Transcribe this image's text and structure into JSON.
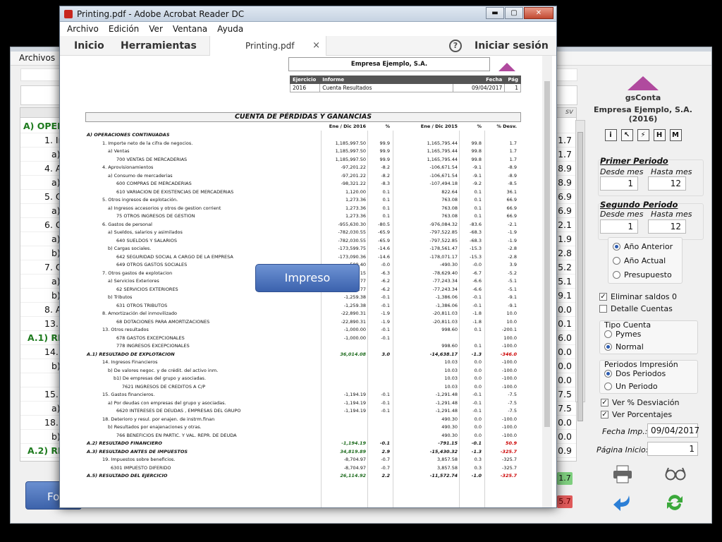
{
  "bg_app": {
    "menu_archivos": "Archivos",
    "rows": [
      {
        "label": "A) OPERA",
        "indent": 18,
        "value": "",
        "green": true
      },
      {
        "label": "1. In",
        "indent": 48,
        "value": "1.7"
      },
      {
        "label": "a)",
        "indent": 58,
        "value": "1.7"
      },
      {
        "label": "4. Ap",
        "indent": 48,
        "value": "8.9"
      },
      {
        "label": "a)",
        "indent": 58,
        "value": "8.9"
      },
      {
        "label": "5. O",
        "indent": 48,
        "value": "6.9"
      },
      {
        "label": "a)",
        "indent": 58,
        "value": "6.9"
      },
      {
        "label": "6. G",
        "indent": 48,
        "value": "2.1"
      },
      {
        "label": "a)",
        "indent": 58,
        "value": "1.9"
      },
      {
        "label": "b)",
        "indent": 58,
        "value": "2.8"
      },
      {
        "label": "7. O",
        "indent": 48,
        "value": "5.2"
      },
      {
        "label": "a)",
        "indent": 58,
        "value": "5.1"
      },
      {
        "label": "b)",
        "indent": 58,
        "value": "9.1"
      },
      {
        "label": "8. Ar",
        "indent": 48,
        "value": "0.0"
      },
      {
        "label": "13. C",
        "indent": 48,
        "value": "0.1"
      },
      {
        "label": "A.1) RES",
        "indent": 24,
        "value": "6.0",
        "green": true
      },
      {
        "label": "14. I",
        "indent": 48,
        "value": "0.0"
      },
      {
        "label": "b)",
        "indent": 58,
        "value": "0.0"
      },
      {
        "label": "",
        "indent": 58,
        "value": "0.0"
      },
      {
        "label": "15. (",
        "indent": 48,
        "value": "7.5"
      },
      {
        "label": "a)",
        "indent": 58,
        "value": "7.5"
      },
      {
        "label": "18. D",
        "indent": 48,
        "value": "0.0"
      },
      {
        "label": "b)",
        "indent": 58,
        "value": "0.0"
      },
      {
        "label": "A.2) RES",
        "indent": 24,
        "value": "0.9",
        "green": true
      }
    ],
    "header_sv": "sv",
    "badge_green": "1.7",
    "badge_red": "5.7",
    "fo_button": "Fo"
  },
  "right_panel": {
    "app_name": "gsConta",
    "company": "Empresa Ejemplo, S.A.",
    "year": "(2016)",
    "tool_icons": [
      "i",
      "↖",
      "⚡",
      "H",
      "M"
    ],
    "primer_periodo": {
      "title": "Primer Periodo",
      "desde_label": "Desde mes",
      "hasta_label": "Hasta mes",
      "desde": "1",
      "hasta": "12"
    },
    "segundo_periodo": {
      "title": "Segundo Periodo",
      "desde_label": "Desde mes",
      "hasta_label": "Hasta mes",
      "desde": "1",
      "hasta": "12"
    },
    "compare_options": [
      "Año Anterior",
      "Año Actual",
      "Presupuesto"
    ],
    "compare_selected": 0,
    "eliminar_saldos": "Eliminar saldos 0",
    "detalle_cuentas": "Detalle Cuentas",
    "tipo_cuenta": {
      "title": "Tipo Cuenta",
      "options": [
        "Pymes",
        "Normal"
      ],
      "selected": 1
    },
    "periodos_impresion": {
      "title": "Periodos Impresión",
      "options": [
        "Dos Periodos",
        "Un Periodo"
      ],
      "selected": 0
    },
    "ver_desviacion": "Ver % Desviación",
    "ver_porcentajes": "Ver Porcentajes",
    "fecha_imp_label": "Fecha Imp.:",
    "fecha_imp": "09/04/2017",
    "pagina_inicio_label": "Página Inicio:",
    "pagina_inicio": "1"
  },
  "acrobat": {
    "title": "Printing.pdf - Adobe Acrobat Reader DC",
    "menu": [
      "Archivo",
      "Edición",
      "Ver",
      "Ventana",
      "Ayuda"
    ],
    "tab_inicio": "Inicio",
    "tab_herramientas": "Herramientas",
    "doc_tab": "Printing.pdf",
    "doc_tab_close": "×",
    "help": "?",
    "signin": "Iniciar sesión",
    "win_min": "▬",
    "win_max": "▢",
    "win_close": "✕"
  },
  "pdf": {
    "company": "Empresa Ejemplo, S.A.",
    "meta_headers": [
      "Ejercicio",
      "Informe",
      "Fecha",
      "Pág"
    ],
    "meta_values": [
      "2016",
      "Cuenta Resultados",
      "09/04/2017",
      "1"
    ],
    "title": "CUENTA DE PÉRDIDAS Y GANANCIAS",
    "col_heads": [
      "Ene / Dic 2016",
      "%",
      "Ene / Dic 2015",
      "%",
      "% Desv."
    ],
    "rows": [
      {
        "t": "sec",
        "l": "A) OPERACIONES CONTINUADAS",
        "i": 2,
        "v": [
          "",
          "",
          "",
          "",
          ""
        ]
      },
      {
        "l": "1. Importe neto de la cifra de negocios.",
        "i": 24,
        "v": [
          "1,185,997.50",
          "99.9",
          "1,165,795.44",
          "99.8",
          "1.7"
        ]
      },
      {
        "l": "a) Ventas",
        "i": 32,
        "v": [
          "1,185,997.50",
          "99.9",
          "1,165,795.44",
          "99.8",
          "1.7"
        ]
      },
      {
        "l": "700  VENTAS DE MERCADERIAS",
        "i": 44,
        "v": [
          "1,185,997.50",
          "99.9",
          "1,165,795.44",
          "99.8",
          "1.7"
        ]
      },
      {
        "l": "4. Aprovisionamientos",
        "i": 24,
        "v": [
          "-97,201.22",
          "-8.2",
          "-106,671.54",
          "-9.1",
          "-8.9"
        ]
      },
      {
        "l": "a) Consumo de mercaderias",
        "i": 32,
        "v": [
          "-97,201.22",
          "-8.2",
          "-106,671.54",
          "-9.1",
          "-8.9"
        ]
      },
      {
        "l": "600  COMPRAS DE MERCADERIAS",
        "i": 44,
        "v": [
          "-98,321.22",
          "-8.3",
          "-107,494.18",
          "-9.2",
          "-8.5"
        ]
      },
      {
        "l": "610  VARIACION DE EXISTENCIAS DE MERCADERIAS",
        "i": 44,
        "v": [
          "1,120.00",
          "0.1",
          "822.64",
          "0.1",
          "36.1"
        ]
      },
      {
        "l": "5. Otros ingresos de explotación.",
        "i": 24,
        "v": [
          "1,273.36",
          "0.1",
          "763.08",
          "0.1",
          "66.9"
        ]
      },
      {
        "l": "a) Ingresos accesorios y otros de gestion corrient",
        "i": 32,
        "v": [
          "1,273.36",
          "0.1",
          "763.08",
          "0.1",
          "66.9"
        ]
      },
      {
        "l": "75  OTROS INGRESOS DE GESTION",
        "i": 44,
        "v": [
          "1,273.36",
          "0.1",
          "763.08",
          "0.1",
          "66.9"
        ]
      },
      {
        "l": "6. Gastos de personal",
        "i": 24,
        "v": [
          "-955,630.30",
          "-80.5",
          "-976,084.32",
          "-83.6",
          "-2.1"
        ]
      },
      {
        "l": "a) Sueldos, salarios y asimilados",
        "i": 32,
        "v": [
          "-782,030.55",
          "-65.9",
          "-797,522.85",
          "-68.3",
          "-1.9"
        ]
      },
      {
        "l": "640  SUELDOS Y SALARIOS",
        "i": 44,
        "v": [
          "-782,030.55",
          "-65.9",
          "-797,522.85",
          "-68.3",
          "-1.9"
        ]
      },
      {
        "l": "b) Cargas sociales.",
        "i": 32,
        "v": [
          "-173,599.75",
          "-14.6",
          "-178,561.47",
          "-15.3",
          "-2.8"
        ]
      },
      {
        "l": "642  SEGURIDAD SOCIAL A CARGO DE LA EMPRESA",
        "i": 44,
        "v": [
          "-173,090.36",
          "-14.6",
          "-178,071.17",
          "-15.3",
          "-2.8"
        ]
      },
      {
        "l": "649  OTROS GASTOS SOCIALES",
        "i": 44,
        "v": [
          "-509.40",
          "-0.0",
          "-490.30",
          "-0.0",
          "3.9"
        ]
      },
      {
        "l": "7. Otros gastos de explotacion",
        "i": 24,
        "v": [
          "-74,950.15",
          "-6.3",
          "-78,629.40",
          "-6.7",
          "-5.2"
        ]
      },
      {
        "l": "a) Servicios Exteriores",
        "i": 32,
        "v": [
          "-73,690.77",
          "-6.2",
          "-77,243.34",
          "-6.6",
          "-5.1"
        ]
      },
      {
        "l": "62  SERVICIOS EXTERIORES",
        "i": 44,
        "v": [
          "-73,690.77",
          "-6.2",
          "-77,243.34",
          "-6.6",
          "-5.1"
        ]
      },
      {
        "l": "b) Tributos",
        "i": 32,
        "v": [
          "-1,259.38",
          "-0.1",
          "-1,386.06",
          "-0.1",
          "-9.1"
        ]
      },
      {
        "l": "631  OTROS TRIBUTOS",
        "i": 44,
        "v": [
          "-1,259.38",
          "-0.1",
          "-1,386.06",
          "-0.1",
          "-9.1"
        ]
      },
      {
        "l": "8. Amortización del inmovilizado",
        "i": 24,
        "v": [
          "-22,890.31",
          "-1.9",
          "-20,811.03",
          "-1.8",
          "10.0"
        ]
      },
      {
        "l": "68  DOTACIONES PARA AMORTIZACIONES",
        "i": 44,
        "v": [
          "-22,890.31",
          "-1.9",
          "-20,811.03",
          "-1.8",
          "10.0"
        ]
      },
      {
        "l": "13. Otros resultados",
        "i": 24,
        "v": [
          "-1,000.00",
          "-0.1",
          "998.60",
          "0.1",
          "-200.1"
        ]
      },
      {
        "l": "678  GASTOS EXCEPCIONALES",
        "i": 44,
        "v": [
          "-1,000.00",
          "-0.1",
          "",
          "",
          "100.0"
        ]
      },
      {
        "l": "778  INGRESOS EXCEPCIONALES",
        "i": 44,
        "v": [
          "",
          "",
          "998.60",
          "0.1",
          "-100.0"
        ]
      },
      {
        "t": "res",
        "l": "A.1) RESULTADO DE EXPLOTACION",
        "i": 2,
        "v": [
          "36,014.08",
          "3.0",
          "-14,638.17",
          "-1.3",
          "-346.0"
        ]
      },
      {
        "l": "14. Ingresos Financieros",
        "i": 24,
        "v": [
          "",
          "",
          "10.03",
          "0.0",
          "-100.0"
        ]
      },
      {
        "l": "b) De valores negoc. y de crédit. del activo inm.",
        "i": 32,
        "v": [
          "",
          "",
          "10.03",
          "0.0",
          "-100.0"
        ]
      },
      {
        "l": "b1) De empresas del grupo y asociadas.",
        "i": 40,
        "v": [
          "",
          "",
          "10.03",
          "0.0",
          "-100.0"
        ]
      },
      {
        "l": "7621  INGRESOS DE CREDITOS A C/P",
        "i": 52,
        "v": [
          "",
          "",
          "10.03",
          "0.0",
          "-100.0"
        ]
      },
      {
        "l": "15. Gastos financieros.",
        "i": 24,
        "v": [
          "-1,194.19",
          "-0.1",
          "-1,291.48",
          "-0.1",
          "-7.5"
        ]
      },
      {
        "l": "a) Por deudas con empresas del grupo y asociadas.",
        "i": 32,
        "v": [
          "-1,194.19",
          "-0.1",
          "-1,291.48",
          "-0.1",
          "-7.5"
        ]
      },
      {
        "l": "6620  INTERESES DE DEUDAS , EMPRESAS DEL GRUPO",
        "i": 44,
        "v": [
          "-1,194.19",
          "-0.1",
          "-1,291.48",
          "-0.1",
          "-7.5"
        ]
      },
      {
        "l": "18. Deterioro y resul. por enajen. de instrm.finan",
        "i": 24,
        "v": [
          "",
          "",
          "490.30",
          "0.0",
          "-100.0"
        ]
      },
      {
        "l": "b) Resultados por enajenaciones y otras.",
        "i": 32,
        "v": [
          "",
          "",
          "490.30",
          "0.0",
          "-100.0"
        ]
      },
      {
        "l": "766  BENEFICIOS EN PARTIC. Y VAL. REPR. DE DEUDA",
        "i": 44,
        "v": [
          "",
          "",
          "490.30",
          "0.0",
          "-100.0"
        ]
      },
      {
        "t": "res",
        "l": "A.2) RESULTADO FINANCIERO",
        "i": 2,
        "v": [
          "-1,194.19",
          "-0.1",
          "-791.15",
          "-0.1",
          "50.9"
        ]
      },
      {
        "t": "res",
        "l": "A.3) RESULTADO ANTES DE IMPUESTOS",
        "i": 2,
        "v": [
          "34,819.89",
          "2.9",
          "-15,430.32",
          "-1.3",
          "-325.7"
        ]
      },
      {
        "l": "19. Impuestos sobre beneficios.",
        "i": 24,
        "v": [
          "-8,704.97",
          "-0.7",
          "3,857.58",
          "0.3",
          "-325.7"
        ]
      },
      {
        "l": "6301  IMPUESTO DIFERIDO",
        "i": 36,
        "v": [
          "-8,704.97",
          "-0.7",
          "3,857.58",
          "0.3",
          "-325.7"
        ]
      },
      {
        "t": "res",
        "l": "A.5) RESULTADO DEL EJERCICIO",
        "i": 2,
        "v": [
          "26,114.92",
          "2.2",
          "-11,572.74",
          "-1.0",
          "-325.7"
        ]
      }
    ]
  },
  "impreso_label": "Impreso"
}
